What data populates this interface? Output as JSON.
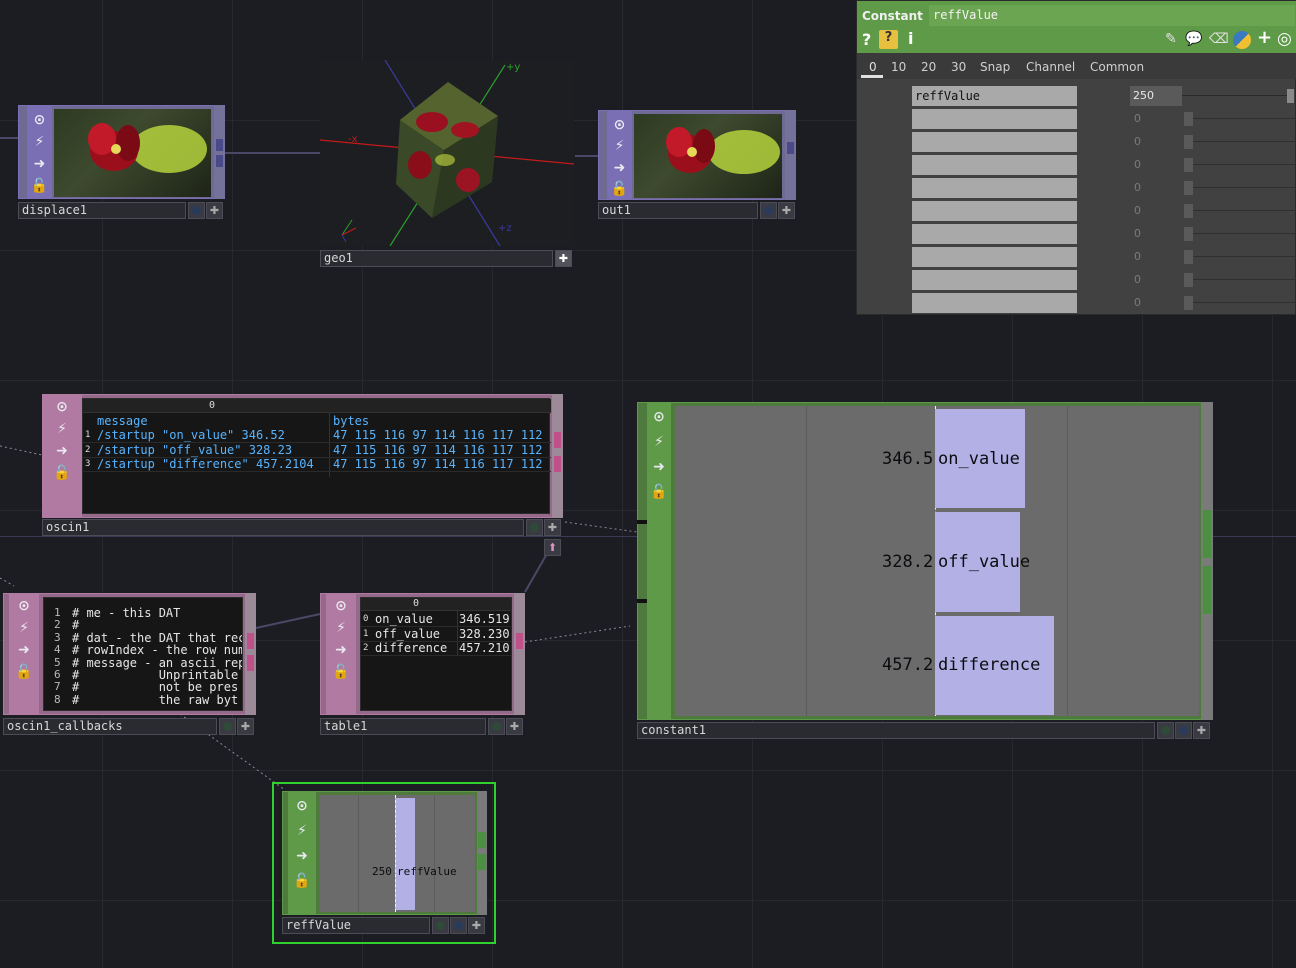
{
  "nodes": {
    "displace1": {
      "name": "displace1"
    },
    "geo1": {
      "name": "geo1",
      "axis_y": "+y",
      "axis_x": "-x",
      "axis_z": "+z"
    },
    "out1": {
      "name": "out1"
    },
    "oscin1": {
      "name": "oscin1",
      "col_index": "0",
      "headers": [
        "message",
        "bytes"
      ],
      "rows": [
        {
          "i": "1",
          "message": "/startup \"on_value\" 346.52",
          "bytes": "47 115 116 97 114 116 117 112"
        },
        {
          "i": "2",
          "message": "/startup \"off_value\" 328.23",
          "bytes": "47 115 116 97 114 116 117 112"
        },
        {
          "i": "3",
          "message": "/startup \"difference\" 457.2104",
          "bytes": "47 115 116 97 114 116 117 112"
        }
      ]
    },
    "oscin1_callbacks": {
      "name": "oscin1_callbacks",
      "lines": [
        {
          "n": "1",
          "t": "# me - this DAT"
        },
        {
          "n": "2",
          "t": "#"
        },
        {
          "n": "3",
          "t": "# dat - the DAT that rec"
        },
        {
          "n": "4",
          "t": "# rowIndex - the row num"
        },
        {
          "n": "5",
          "t": "# message - an ascii rep"
        },
        {
          "n": "6",
          "t": "#           Unprintable"
        },
        {
          "n": "7",
          "t": "#           not be pres"
        },
        {
          "n": "8",
          "t": "#           the raw byt"
        }
      ]
    },
    "table1": {
      "name": "table1",
      "col_index": "0",
      "rows": [
        {
          "i": "0",
          "k": "on_value",
          "v": "346.519"
        },
        {
          "i": "1",
          "k": "off_value",
          "v": "328.230"
        },
        {
          "i": "2",
          "k": "difference",
          "v": "457.210"
        }
      ]
    },
    "constant1": {
      "name": "constant1",
      "channels": [
        {
          "value": "346.5",
          "label": "on_value"
        },
        {
          "value": "328.2",
          "label": "off_value"
        },
        {
          "value": "457.2",
          "label": "difference"
        }
      ]
    },
    "reffValue": {
      "name": "reffValue",
      "channel": {
        "value": "250",
        "label": "reffValue"
      }
    }
  },
  "param_panel": {
    "op_type": "Constant",
    "op_name": "reffValue",
    "tabs": [
      "0",
      "10",
      "20",
      "30",
      "Snap",
      "Channel",
      "Common"
    ],
    "active_tab": "0",
    "rows": [
      {
        "name": "reffValue",
        "value": "250"
      },
      {
        "name": "",
        "value": "0"
      },
      {
        "name": "",
        "value": "0"
      },
      {
        "name": "",
        "value": "0"
      },
      {
        "name": "",
        "value": "0"
      },
      {
        "name": "",
        "value": "0"
      },
      {
        "name": "",
        "value": "0"
      },
      {
        "name": "",
        "value": "0"
      },
      {
        "name": "",
        "value": "0"
      },
      {
        "name": "",
        "value": "0"
      }
    ]
  },
  "colors": {
    "top_family": "#7a6fb5",
    "dat_family": "#b07aa2",
    "chop_family": "#5e9a48",
    "channel_bar": "#b3b0e6",
    "selected_outline": "#2fd12f"
  }
}
